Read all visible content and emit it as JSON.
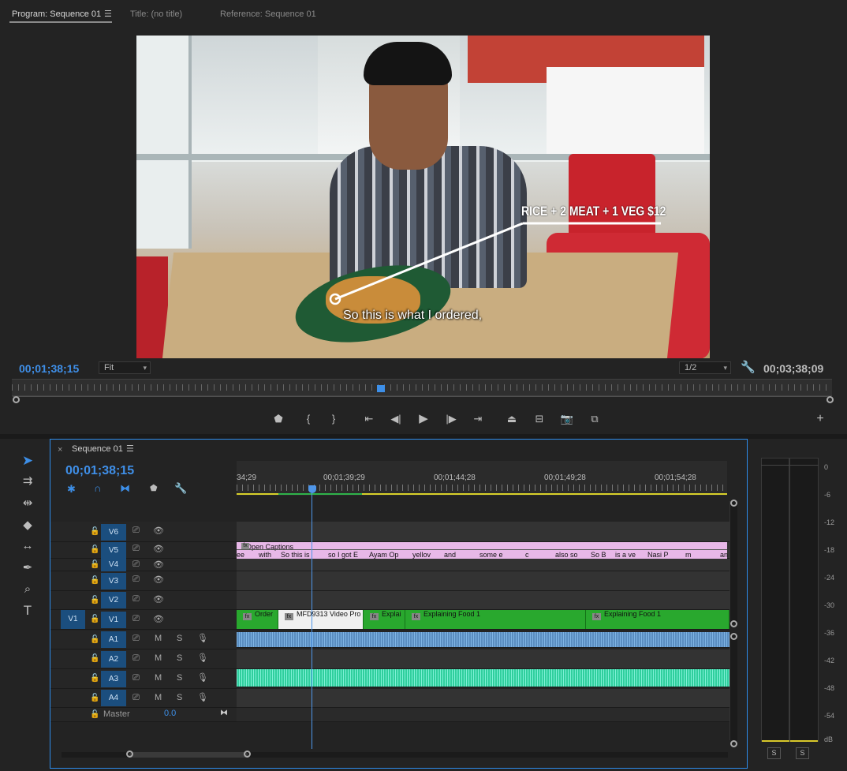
{
  "program_monitor": {
    "tabs": [
      {
        "label": "Program: Sequence 01"
      },
      {
        "label": "Title: (no title)"
      },
      {
        "label": "Reference: Sequence 01"
      }
    ],
    "menu_icon": "hamburger-icon",
    "overlay_text": "RICE + 2 MEAT + 1 VEG $12",
    "caption": "So this is what I ordered,",
    "current_timecode": "00;01;38;15",
    "fit_dropdown": "Fit",
    "resolution_dropdown": "1/2",
    "duration_timecode": "00;03;38;09",
    "playhead_fraction": 0.45
  },
  "timeline": {
    "close_x": "×",
    "title": "Sequence 01",
    "timecode": "00;01;38;15",
    "ruler_labels": [
      "34;29",
      "00;01;39;29",
      "00;01;44;28",
      "00;01;49;28",
      "00;01;54;28"
    ],
    "video_tracks": [
      {
        "name": "V6"
      },
      {
        "name": "V5"
      },
      {
        "name": "V4"
      },
      {
        "name": "V3"
      },
      {
        "name": "V2"
      },
      {
        "name": "V1"
      }
    ],
    "source_patch": "V1",
    "audio_tracks": [
      {
        "name": "A1",
        "m": "M",
        "s": "S"
      },
      {
        "name": "A2",
        "m": "M",
        "s": "S"
      },
      {
        "name": "A3",
        "m": "M",
        "s": "S"
      },
      {
        "name": "A4",
        "m": "M",
        "s": "S"
      }
    ],
    "master_label": "Master",
    "master_value": "0.0",
    "fx_label": "fx",
    "caption_clips": [
      "Open Captions",
      "ee",
      "with",
      "So this is",
      "so I got E",
      "Ayam Op",
      "yellov",
      "and",
      "some e",
      "c",
      "also so",
      "So B",
      "is a ve",
      "Nasi P",
      "m",
      "an"
    ],
    "v1_clips": [
      "Order",
      "MFD9313 Video Pro",
      "Explai",
      "Explaining Food 1",
      "Explaining Food 1"
    ]
  },
  "meter": {
    "db_labels": [
      "0",
      "-6",
      "-12",
      "-18",
      "-24",
      "-30",
      "-36",
      "-42",
      "-48",
      "-54",
      "dB"
    ],
    "solo_buttons": [
      "S",
      "S"
    ]
  }
}
